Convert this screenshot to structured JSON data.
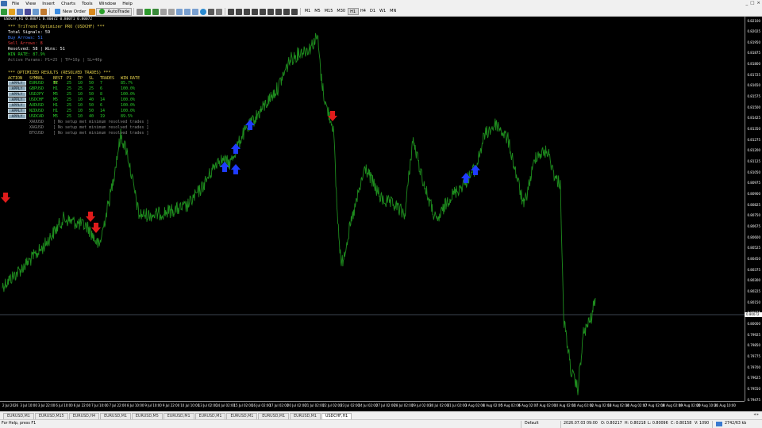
{
  "menubar": {
    "items": [
      "File",
      "View",
      "Insert",
      "Charts",
      "Tools",
      "Window",
      "Help"
    ]
  },
  "toolbar": {
    "new_order_label": "New Order",
    "autotrade_label": "AutoTrade",
    "timeframes": [
      "M1",
      "M5",
      "M15",
      "M30",
      "H1",
      "H4",
      "D1",
      "W1",
      "MN"
    ],
    "active_timeframe": "H1"
  },
  "chart": {
    "title": "USDCHF,H1 0.80071 0.80072 0.80071 0.80072",
    "line_color": "#1e8c1e",
    "background": "#000000",
    "current_price": "0.80072",
    "price_ticks": [
      "0.82100",
      "0.82025",
      "0.81950",
      "0.81875",
      "0.81800",
      "0.81725",
      "0.81650",
      "0.81575",
      "0.81500",
      "0.81425",
      "0.81350",
      "0.81275",
      "0.81200",
      "0.81125",
      "0.81050",
      "0.80975",
      "0.80900",
      "0.80825",
      "0.80750",
      "0.80675",
      "0.80600",
      "0.80525",
      "0.80450",
      "0.80375",
      "0.80300",
      "0.80225",
      "0.80150",
      "0.80075",
      "0.80000",
      "0.79925",
      "0.79850",
      "0.79775",
      "0.79700",
      "0.79625",
      "0.79550",
      "0.79475"
    ],
    "time_ticks": [
      "2 Jul 2026",
      "3 Jul 10:00",
      "3 Jul 22:00",
      "6 Jul 10:00",
      "6 Jul 22:00",
      "7 Jul 10:00",
      "7 Jul 22:00",
      "8 Jul 10:00",
      "9 Jul 10:00",
      "9 Jul 22:00",
      "10 Jul 10:00",
      "13 Jul 02:00",
      "14 Jul 02:00",
      "15 Jul 02:00",
      "16 Jul 02:00",
      "17 Jul 02:00",
      "20 Jul 02:00",
      "21 Jul 02:00",
      "22 Jul 02:00",
      "23 Jul 02:00",
      "24 Jul 02:00",
      "27 Jul 02:00",
      "28 Jul 02:00",
      "29 Jul 02:00",
      "30 Jul 02:00",
      "31 Jul 02:00",
      "3 Aug 02:00",
      "4 Aug 02:00",
      "5 Aug 02:00",
      "6 Aug 02:00",
      "7 Aug 02:00",
      "10 Aug 02:00",
      "11 Aug 02:00",
      "12 Aug 02:00",
      "13 Aug 02:00",
      "14 Aug 02:00",
      "17 Aug 02:00",
      "18 Aug 02:00",
      "19 Aug 02:00",
      "20 Aug 10:00",
      "21 Aug 10:00"
    ]
  },
  "panel": {
    "title": "*** TriTrend Optimizer PRO (USDCHF) ***",
    "total_signals": "Total Signals: 59",
    "buy_arrows": "Buy Arrows: 51",
    "sell_arrows": "Sell Arrows: 8",
    "resolved": "Resolved: 58 | Wins: 51",
    "win_rate": "WIN RATE: 87.9%",
    "active_params": "Active Params: P1=25 | TP=10p | SL=40p"
  },
  "results": {
    "title": "*** OPTIMIZED RESULTS (RESOLVED TRADES) ***",
    "headers": [
      "ACTION",
      "SYMBOL",
      "BEST TF",
      "P1",
      "TP",
      "SL",
      "TRADES",
      "WIN RATE"
    ],
    "apply_label": "APPLY",
    "rows": [
      [
        "EURUSD",
        "H1",
        "25",
        "10",
        "50",
        "7",
        "85.7%"
      ],
      [
        "GBPUSD",
        "H1",
        "25",
        "25",
        "25",
        "6",
        "100.0%"
      ],
      [
        "USDJPY",
        "M5",
        "25",
        "10",
        "50",
        "8",
        "100.0%"
      ],
      [
        "USDCHF",
        "M5",
        "25",
        "10",
        "40",
        "14",
        "100.0%"
      ],
      [
        "AUDUSD",
        "H1",
        "25",
        "10",
        "50",
        "6",
        "100.0%"
      ],
      [
        "NZDUSD",
        "H1",
        "25",
        "10",
        "50",
        "14",
        "100.0%"
      ],
      [
        "USDCAD",
        "M5",
        "25",
        "10",
        "40",
        "19",
        "89.5%"
      ]
    ],
    "none_rows": [
      [
        "XAUUSD",
        "[ No setup met minimum resolved trades ]"
      ],
      [
        "XAGUSD",
        "[ No setup met minimum resolved trades ]"
      ],
      [
        "BTCUSD",
        "[ No setup met minimum resolved trades ]"
      ]
    ]
  },
  "tabs": {
    "items": [
      "EURUSD,M1",
      "EURUSD,M15",
      "EURUSD,H4",
      "EURUSD,M1",
      "EURUSD,M5",
      "EURUSD,M1",
      "EURUSD,M1",
      "EURUSD,M1",
      "EURUSD,M1",
      "EURUSD,M1",
      "USDCHF,H1"
    ],
    "active_index": 10
  },
  "status": {
    "help": "For Help, press F1",
    "profile": "Default",
    "datetime": "2026.07.03 09:00",
    "open": "O: 0.80217",
    "high": "H: 0.80218",
    "low": "L: 0.80096",
    "close": "C: 0.80158",
    "volume": "V: 1090",
    "traffic": "2742/63 kb"
  }
}
